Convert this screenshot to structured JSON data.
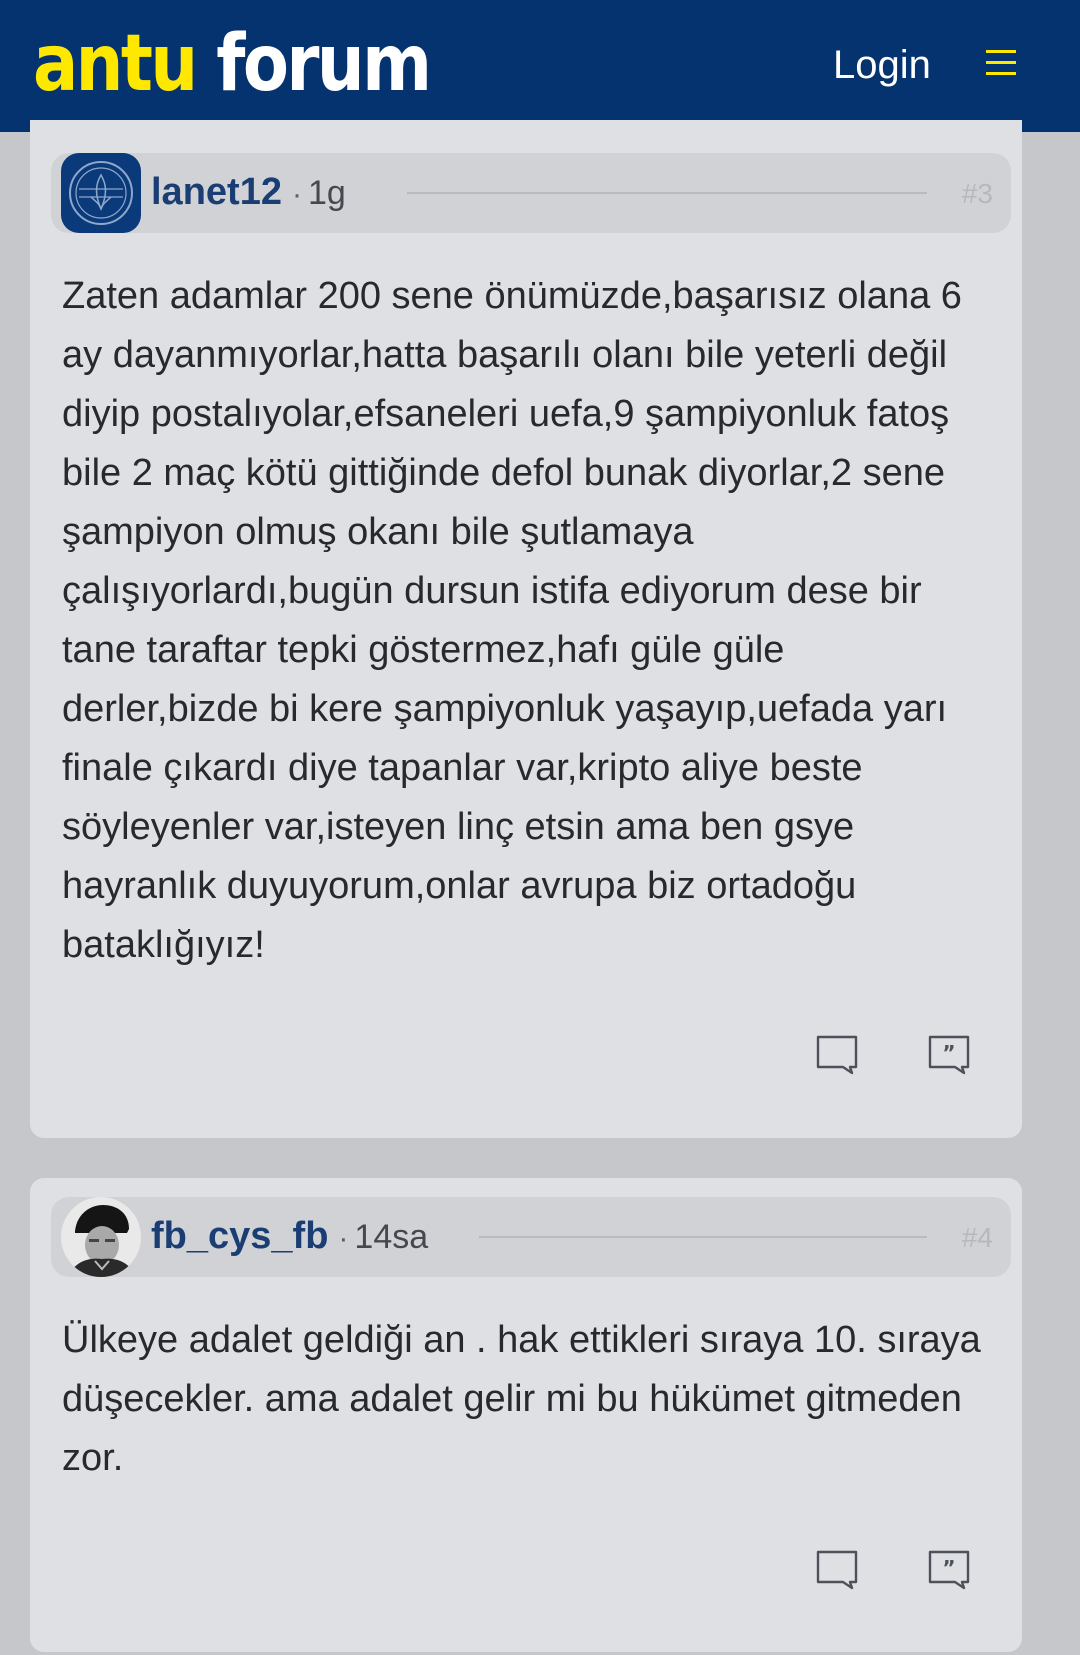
{
  "header": {
    "logo_part1": "antu",
    "logo_part2": "forum",
    "login_label": "Login",
    "menu_icon": "hamburger-menu-icon"
  },
  "posts": [
    {
      "username": "lanet12",
      "time": "1g",
      "number": "#3",
      "avatar": "club-crest-avatar",
      "body": "Zaten adamlar 200 sene önümüzde,başarısız olana 6 ay dayanmıyorlar,hatta başarılı olanı bile yeterli değil diyip postalıyolar,efsaneleri uefa,9 şampiyonluk fatoş bile 2 maç kötü gittiğinde defol bunak diyorlar,2 sene şampiyon olmuş okanı bile şutlamaya çalışıyorlardı,bugün dursun istifa ediyorum dese bir tane taraftar tepki göstermez,hafı güle güle derler,bizde bi kere şampiyonluk yaşayıp,uefada yarı finale çıkardı diye tapanlar var,kripto aliye beste söyleyenler var,isteyen linç etsin ama ben gsye hayranlık duyuyorum,onlar avrupa biz ortadoğu bataklığıyız!",
      "actions": [
        "comment-icon",
        "quote-icon"
      ]
    },
    {
      "username": "fb_cys_fb",
      "time": "14sa",
      "number": "#4",
      "avatar": "portrait-photo-avatar",
      "body": "Ülkeye adalet geldiği an . hak ettikleri sıraya 10. sıraya düşecekler. ama adalet gelir mi bu hükümet gitmeden zor.",
      "actions": [
        "comment-icon",
        "quote-icon"
      ]
    }
  ],
  "colors": {
    "header_bg": "#04336f",
    "logo_yellow": "#ffe800",
    "username_blue": "#1a3e74",
    "card_bg": "#dfe0e4",
    "page_bg": "#c6c7cb"
  }
}
